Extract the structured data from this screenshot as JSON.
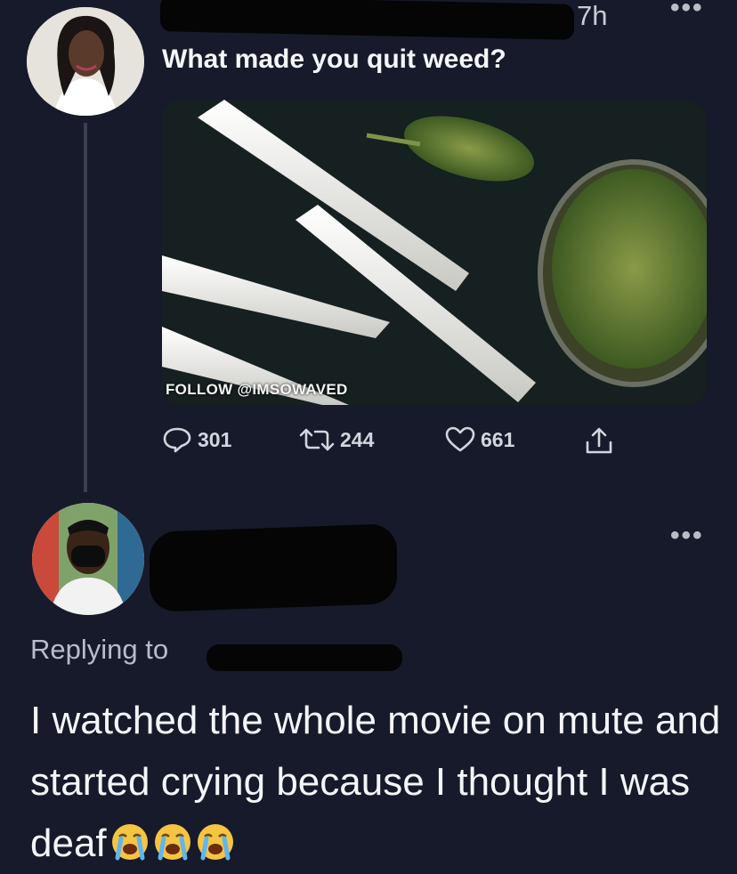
{
  "tweet": {
    "time": "7h",
    "more_label": "•••",
    "text": "What made you quit weed?",
    "media_watermark": "FOLLOW @IMSOWAVED",
    "stats": {
      "replies": "301",
      "retweets": "244",
      "likes": "661"
    }
  },
  "reply": {
    "more_label": "•••",
    "replying_to_label": "Replying to",
    "text": "I watched the whole movie on mute and started crying because I thought I was deaf",
    "emoji": [
      "loudly-crying-face",
      "loudly-crying-face",
      "loudly-crying-face"
    ]
  },
  "colors": {
    "background": "#171a2a",
    "text": "#f2f3f7",
    "muted": "#b8bccb"
  }
}
